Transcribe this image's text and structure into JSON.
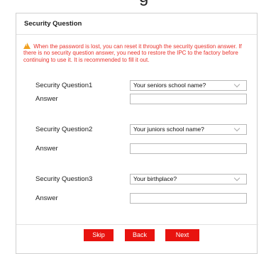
{
  "top_fragment": "g",
  "dialog": {
    "title": "Security Question",
    "notice": "When the password is lost, you can reset it through the security question answer. If there is no security question answer, you need to restore the IPC to the factory before continuing to use it. It is recommended to fill it out.",
    "questions": [
      {
        "label": "Security Question1",
        "value": "Your seniors school name?",
        "answer_label": "Answer",
        "answer_value": ""
      },
      {
        "label": "Security Question2",
        "value": "Your juniors school name?",
        "answer_label": "Answer",
        "answer_value": ""
      },
      {
        "label": "Security Question3",
        "value": "Your birthplace?",
        "answer_label": "Answer",
        "answer_value": ""
      }
    ],
    "buttons": {
      "skip": "Skip",
      "back": "Back",
      "next": "Next"
    }
  },
  "colors": {
    "accent": "#e8130f",
    "warning_text": "#e8332c",
    "warning_icon": "#f0a020"
  },
  "icons": {
    "notice": "warning-icon",
    "select": "chevron-down-icon"
  }
}
